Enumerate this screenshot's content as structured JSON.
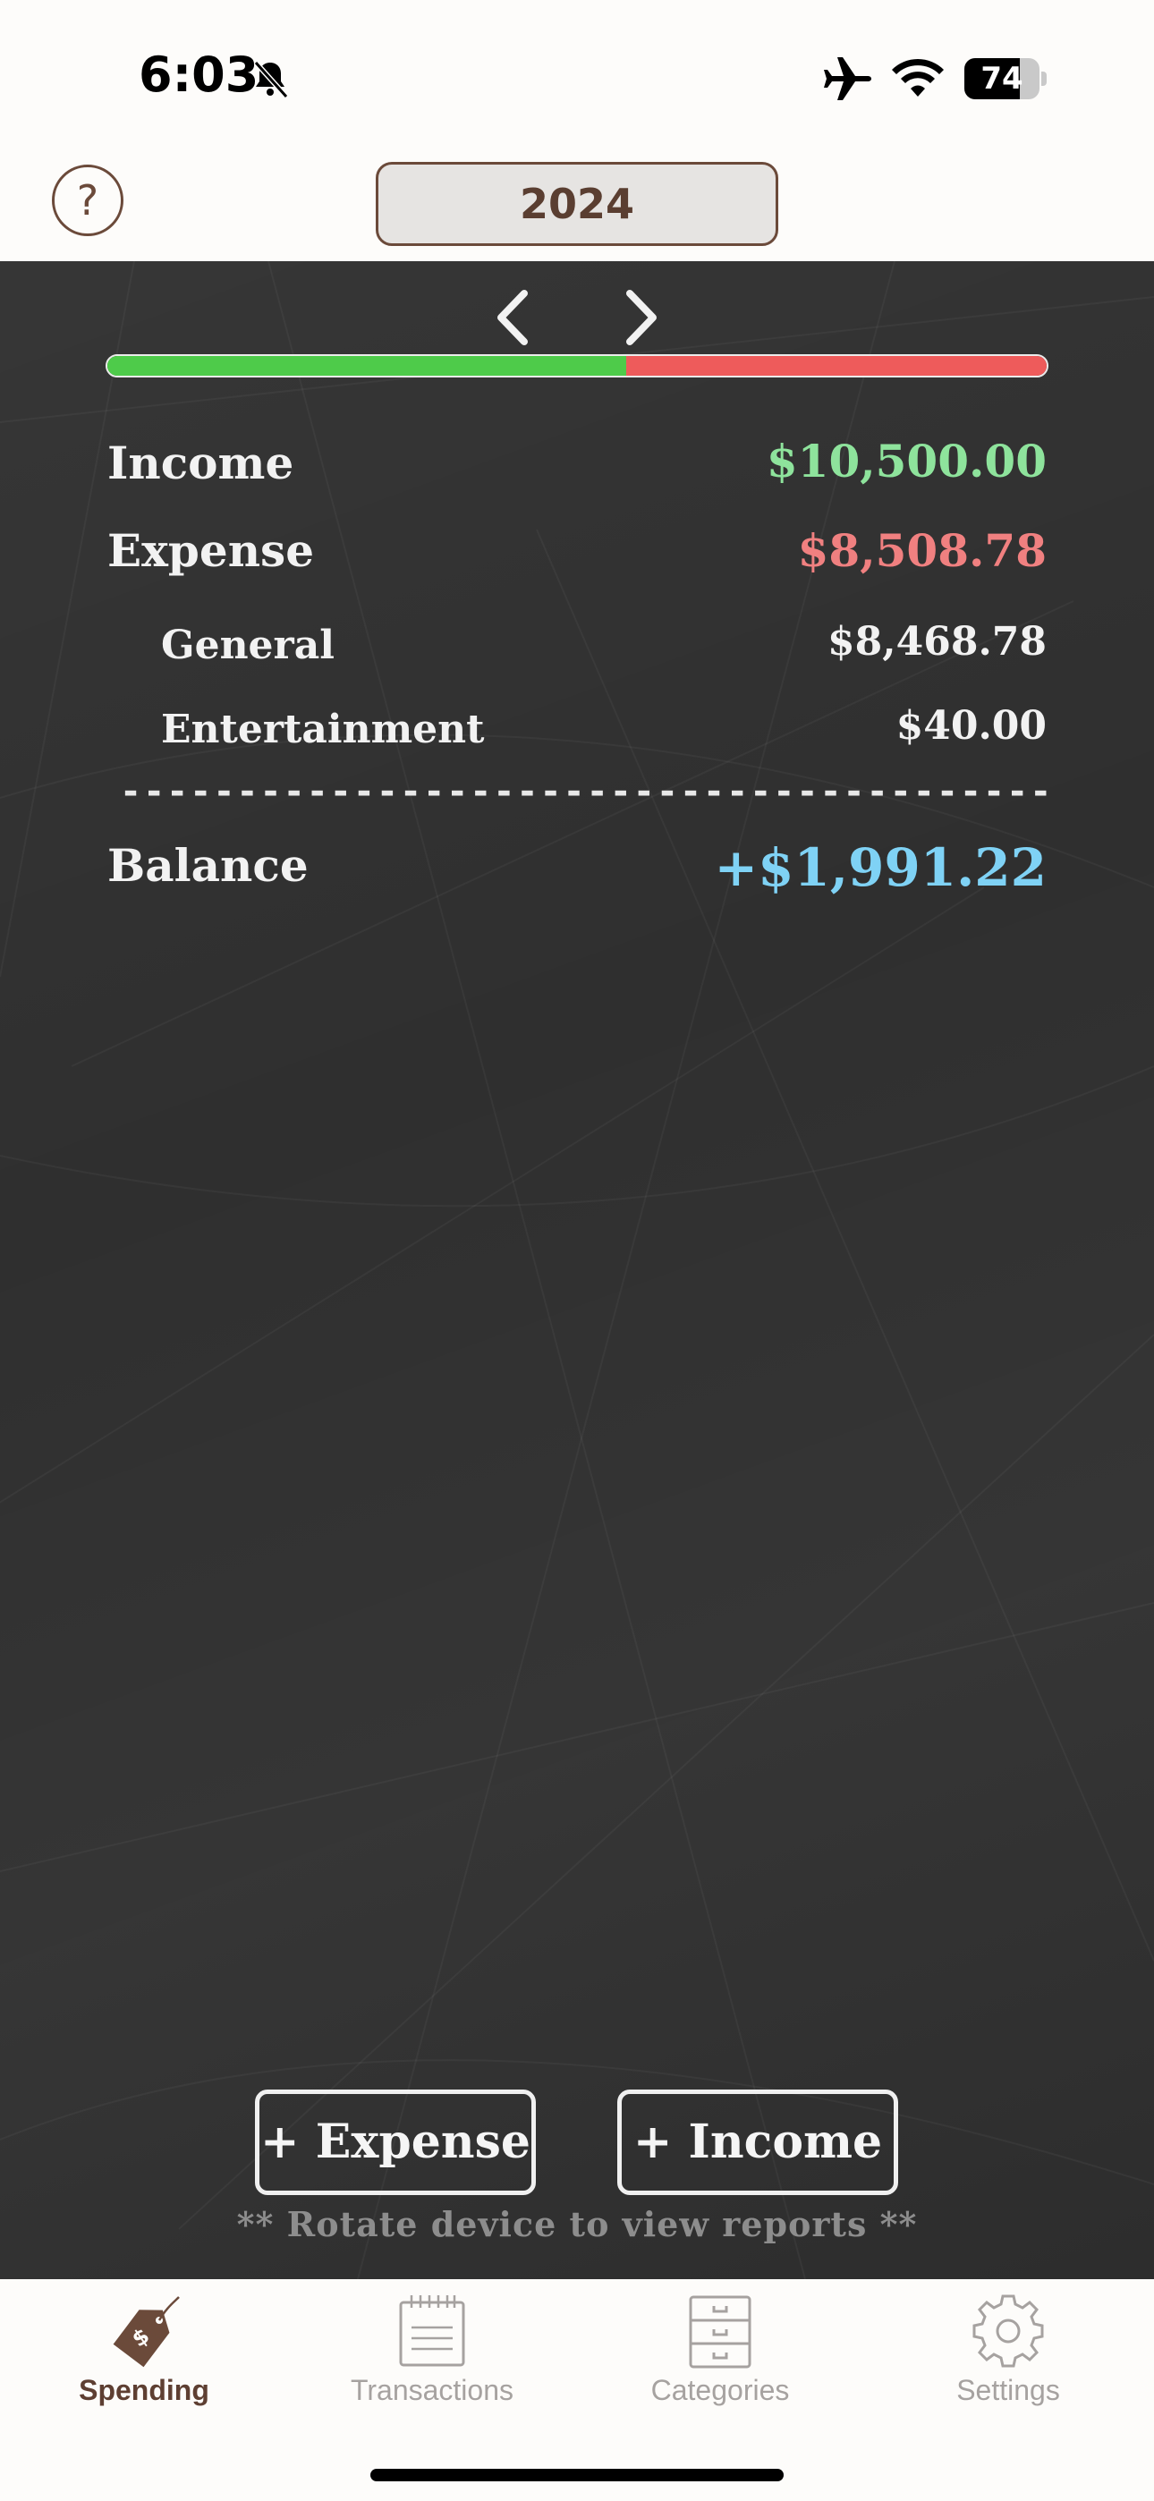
{
  "status_bar": {
    "time": "6:03",
    "battery_percent": "74",
    "battery_level": 0.74,
    "icons": [
      "bell-slash-icon",
      "airplane-icon",
      "wifi-icon",
      "battery-icon"
    ]
  },
  "header": {
    "help_label": "?",
    "year_label": "2024"
  },
  "summary": {
    "income_share": 0.552,
    "income": {
      "label": "Income",
      "value": "$10,500.00"
    },
    "expense": {
      "label": "Expense",
      "value": "$8,508.78"
    },
    "categories": [
      {
        "label": "General",
        "value": "$8,468.78"
      },
      {
        "label": "Entertainment",
        "value": "$40.00"
      }
    ],
    "divider": "----------------------------------------",
    "balance": {
      "label": "Balance",
      "value": "+$1,991.22"
    }
  },
  "actions": {
    "add_expense": "+ Expense",
    "add_income": "+ Income",
    "rotate_hint": "** Rotate device to view reports **"
  },
  "tabbar": {
    "tabs": [
      {
        "label": "Spending",
        "icon": "price-tag-icon",
        "active": true
      },
      {
        "label": "Transactions",
        "icon": "notepad-icon",
        "active": false
      },
      {
        "label": "Categories",
        "icon": "file-cabinet-icon",
        "active": false
      },
      {
        "label": "Settings",
        "icon": "gear-icon",
        "active": false
      }
    ]
  },
  "colors": {
    "income_green": "#8ee39c",
    "expense_red": "#f08080",
    "balance_blue": "#7fd2f5",
    "brand_brown": "#6b4a3a",
    "board": "#2f2f2f"
  }
}
